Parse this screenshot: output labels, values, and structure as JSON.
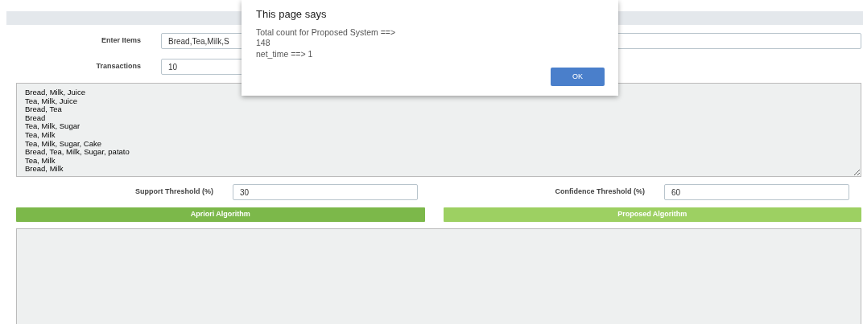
{
  "form": {
    "items_label": "Enter Items",
    "items_value": "Bread,Tea,Milk,S",
    "transactions_label": "Transactions",
    "transactions_value": "10"
  },
  "transactions_text": [
    "Bread, Milk, Juice",
    "Tea, Milk, Juice",
    "Bread, Tea",
    "Bread",
    "Tea, Milk, Sugar",
    "Tea, Milk",
    "Tea, Milk, Sugar, Cake",
    "Bread, Tea, Milk, Sugar, patato",
    "Tea, Milk",
    "Bread, Milk"
  ],
  "thresholds": [
    {
      "label": "Support Threshold (%)",
      "value": "30"
    },
    {
      "label": "Confidence Threshold (%)",
      "value": "60"
    }
  ],
  "buttons": [
    {
      "label": "Apriori Algorithm",
      "color": "#7cb84a"
    },
    {
      "label": "Proposed Algorithm",
      "color": "#9dd062"
    }
  ],
  "dialog": {
    "title": "This page says",
    "lines": [
      "Total count for Proposed System ==>",
      "148",
      "net_time ==> 1"
    ],
    "button": "OK"
  }
}
